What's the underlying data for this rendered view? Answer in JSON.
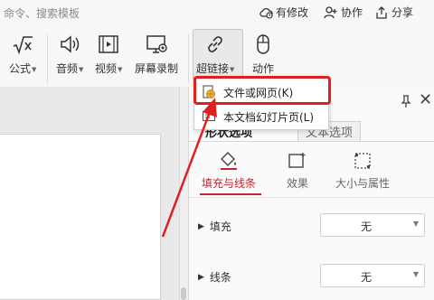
{
  "topbar": {
    "search_hint": "命令、搜索模板",
    "unsaved_label": "有修改",
    "collab_label": "协作",
    "share_label": "分享"
  },
  "ribbon": {
    "formula_label": "公式",
    "audio_label": "音频",
    "video_label": "视频",
    "screen_record_label": "屏幕录制",
    "hyperlink_label": "超链接",
    "action_label": "动作"
  },
  "hyperlink_menu": {
    "items": [
      {
        "label": "文件或网页(K)",
        "icon": "web-file-icon"
      },
      {
        "label": "本文档幻灯片页(L)",
        "icon": "slide-page-icon"
      }
    ]
  },
  "panel": {
    "tab_shape_options": "形状选项",
    "tab_text_options": "文本选项",
    "fill_line_label": "填充与线条",
    "effects_label": "效果",
    "size_props_label": "大小与属性",
    "fill_label": "填充",
    "fill_value": "无",
    "line_label": "线条",
    "line_value": "无"
  },
  "colors": {
    "accent_red": "#c0282d",
    "highlight_red": "#e02020"
  }
}
